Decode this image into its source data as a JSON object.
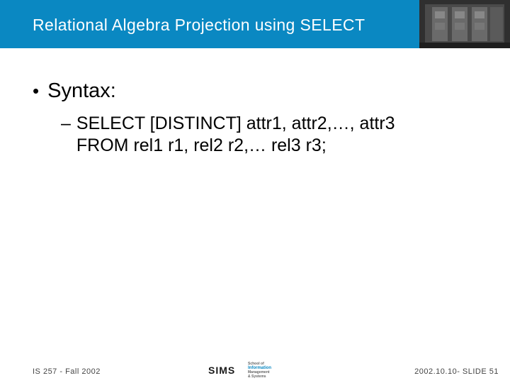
{
  "title": "Relational Algebra Projection using SELECT",
  "body": {
    "bullet1": "Syntax:",
    "sub1_line1": "SELECT  [DISTINCT] attr1, attr2,…, attr3",
    "sub1_line2": "FROM rel1 r1, rel2 r2,… rel3 r3;"
  },
  "footer": {
    "left": "IS 257 - Fall 2002",
    "right": "2002.10.10- SLIDE 51",
    "logo_main": "SIMS",
    "logo_top_small": "School of",
    "logo_info": "Information",
    "logo_mgmt": "Management",
    "logo_sys": "& Systems"
  }
}
